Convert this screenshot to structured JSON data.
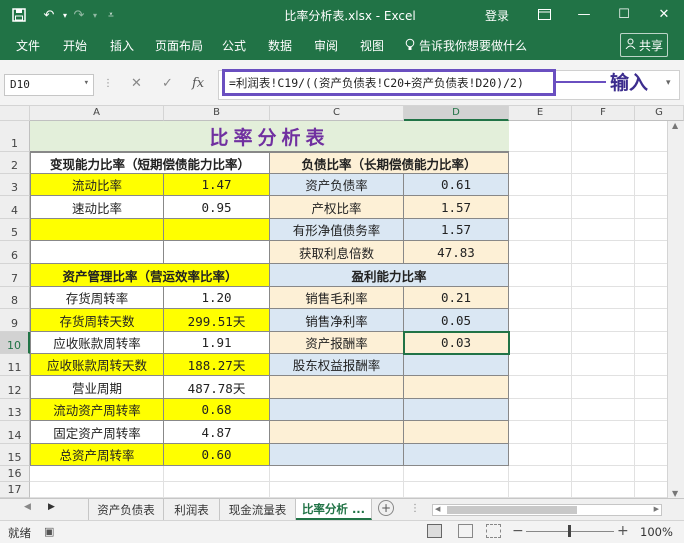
{
  "titlebar": {
    "doc_title": "比率分析表.xlsx  -  Excel",
    "login": "登录",
    "save_icon": "save-icon",
    "undo_icon": "undo-icon",
    "redo_icon": "redo-icon"
  },
  "ribbon": {
    "tabs": [
      "文件",
      "开始",
      "插入",
      "页面布局",
      "公式",
      "数据",
      "审阅",
      "视图"
    ],
    "tell_me": "告诉我你想要做什么",
    "share": "共享"
  },
  "formula_bar": {
    "name_box": "D10",
    "formula": "=利润表!C19/((资产负债表!C20+资产负债表!D20)/2)",
    "annotation": "输入"
  },
  "columns": [
    "A",
    "B",
    "C",
    "D",
    "E",
    "F",
    "G"
  ],
  "rows": [
    "1",
    "2",
    "3",
    "4",
    "5",
    "6",
    "7",
    "8",
    "9",
    "10",
    "11",
    "12",
    "13",
    "14",
    "15",
    "16",
    "17"
  ],
  "sheet": {
    "title": "比率分析表",
    "liquidity_header": "变现能力比率（短期偿债能力比率）",
    "debt_header": "负债比率（长期偿债能力比率）",
    "mgmt_header": "资产管理比率（营运效率比率）",
    "profit_header": "盈利能力比率",
    "left_rows": [
      {
        "label": "流动比率",
        "value": "1.47"
      },
      {
        "label": "速动比率",
        "value": "0.95"
      },
      {
        "label": "",
        "value": ""
      },
      {
        "label": "",
        "value": ""
      },
      {
        "label": "",
        "value": ""
      },
      {
        "label": "存货周转率",
        "value": "1.20"
      },
      {
        "label": "存货周转天数",
        "value": "299.51天"
      },
      {
        "label": "应收账款周转率",
        "value": "1.91"
      },
      {
        "label": "应收账款周转天数",
        "value": "188.27天"
      },
      {
        "label": "营业周期",
        "value": "487.78天"
      },
      {
        "label": "流动资产周转率",
        "value": "0.68"
      },
      {
        "label": "固定资产周转率",
        "value": "4.87"
      },
      {
        "label": "总资产周转率",
        "value": "0.60"
      }
    ],
    "right_rows": [
      {
        "label": "资产负债率",
        "value": "0.61"
      },
      {
        "label": "产权比率",
        "value": "1.57"
      },
      {
        "label": "有形净值债务率",
        "value": "1.57"
      },
      {
        "label": "获取利息倍数",
        "value": "47.83"
      },
      {
        "label": "",
        "value": ""
      },
      {
        "label": "销售毛利率",
        "value": "0.21"
      },
      {
        "label": "销售净利率",
        "value": "0.05"
      },
      {
        "label": "资产报酬率",
        "value": "0.03"
      },
      {
        "label": "股东权益报酬率",
        "value": ""
      },
      {
        "label": "",
        "value": ""
      },
      {
        "label": "",
        "value": ""
      },
      {
        "label": "",
        "value": ""
      },
      {
        "label": "",
        "value": ""
      }
    ]
  },
  "sheet_tabs": [
    "资产负债表",
    "利润表",
    "现金流量表",
    "比率分析 ..."
  ],
  "status": {
    "ready": "就绪",
    "zoom": "100%"
  },
  "colors": {
    "excel_green": "#217346",
    "yellow": "#ffff00",
    "light_blue": "#dae7f3",
    "peach": "#fdf0d6",
    "title_purple": "#7030a0",
    "annotation_purple": "#6a4fc0"
  }
}
